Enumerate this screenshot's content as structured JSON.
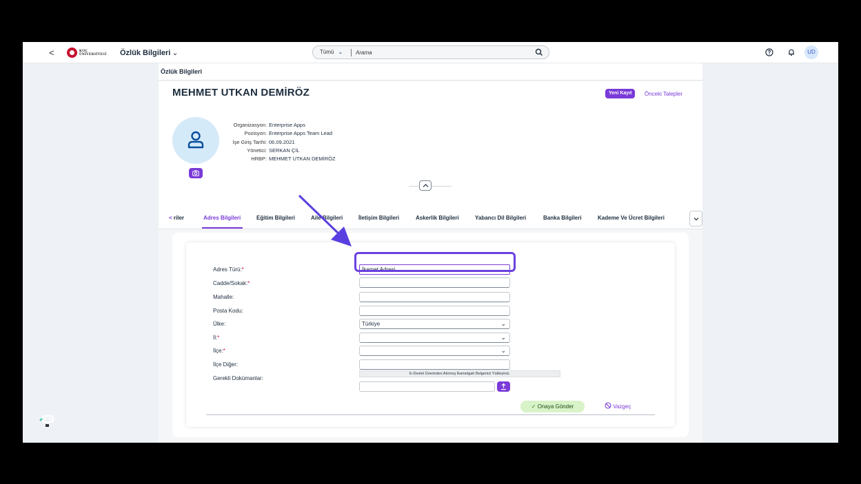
{
  "shell": {
    "logo_text_line1": "KOÇ",
    "logo_text_line2": "ÜNİVERSİTESİ",
    "app_title": "Özlük Bilgileri",
    "search_category": "Tümü",
    "search_placeholder": "Arama",
    "avatar_initials": "UD"
  },
  "page": {
    "heading": "Özlük Bilgileri"
  },
  "employee": {
    "name": "MEHMET UTKAN DEMİRÖZ",
    "new_record_label": "Yeni Kayıt",
    "previous_requests_label": "Önceki Talepler",
    "info": [
      {
        "label": "Organizasyon:",
        "value": "Enterprise Apps"
      },
      {
        "label": "Pozisyon:",
        "value": "Enterprise Apps Team Lead"
      },
      {
        "label": "İşe Giriş Tarihi:",
        "value": "06.09.2021"
      },
      {
        "label": "Yönetici:",
        "value": "SERKAN ÇİL"
      },
      {
        "label": "HRBP:",
        "value": "MEHMET UTKAN DEMİRÖZ"
      }
    ]
  },
  "tabs": {
    "partial_left": "riler",
    "items": [
      {
        "label": "Adres Bilgileri",
        "active": true
      },
      {
        "label": "Eğitim Bilgileri",
        "active": false
      },
      {
        "label": "Aile Bilgileri",
        "active": false
      },
      {
        "label": "İletişim Bilgileri",
        "active": false
      },
      {
        "label": "Askerlik Bilgileri",
        "active": false
      },
      {
        "label": "Yabancı Dil Bilgileri",
        "active": false
      },
      {
        "label": "Banka Bilgileri",
        "active": false
      },
      {
        "label": "Kademe Ve Ücret Bilgileri",
        "active": false
      }
    ]
  },
  "form": {
    "fields": [
      {
        "label": "Adres Türü:",
        "required": true,
        "type": "select",
        "value": "İkamet Adresi"
      },
      {
        "label": "Cadde/Sokak:",
        "required": true,
        "type": "text",
        "value": ""
      },
      {
        "label": "Mahalle:",
        "required": false,
        "type": "text",
        "value": ""
      },
      {
        "label": "Posta Kodu:",
        "required": false,
        "type": "text",
        "value": ""
      },
      {
        "label": "Ülke:",
        "required": false,
        "type": "select",
        "value": "Türkiye"
      },
      {
        "label": "İl:",
        "required": true,
        "type": "select",
        "value": ""
      },
      {
        "label": "İlçe:",
        "required": true,
        "type": "select",
        "value": ""
      },
      {
        "label": "İlçe Diğer:",
        "required": false,
        "type": "text",
        "value": ""
      }
    ],
    "documents_label": "Gerekli Dokümanlar:",
    "documents_note": "E-Devlet Üzerinden Alınmış İkametgah Belgenizi Yükleyiniz.",
    "submit_label": "Onaya Gönder",
    "cancel_label": "Vazgeç"
  },
  "colors": {
    "accent": "#7a3bd8",
    "highlight": "#6a41e0",
    "submit_bg": "#d9f3c8",
    "required": "#c8102e"
  }
}
